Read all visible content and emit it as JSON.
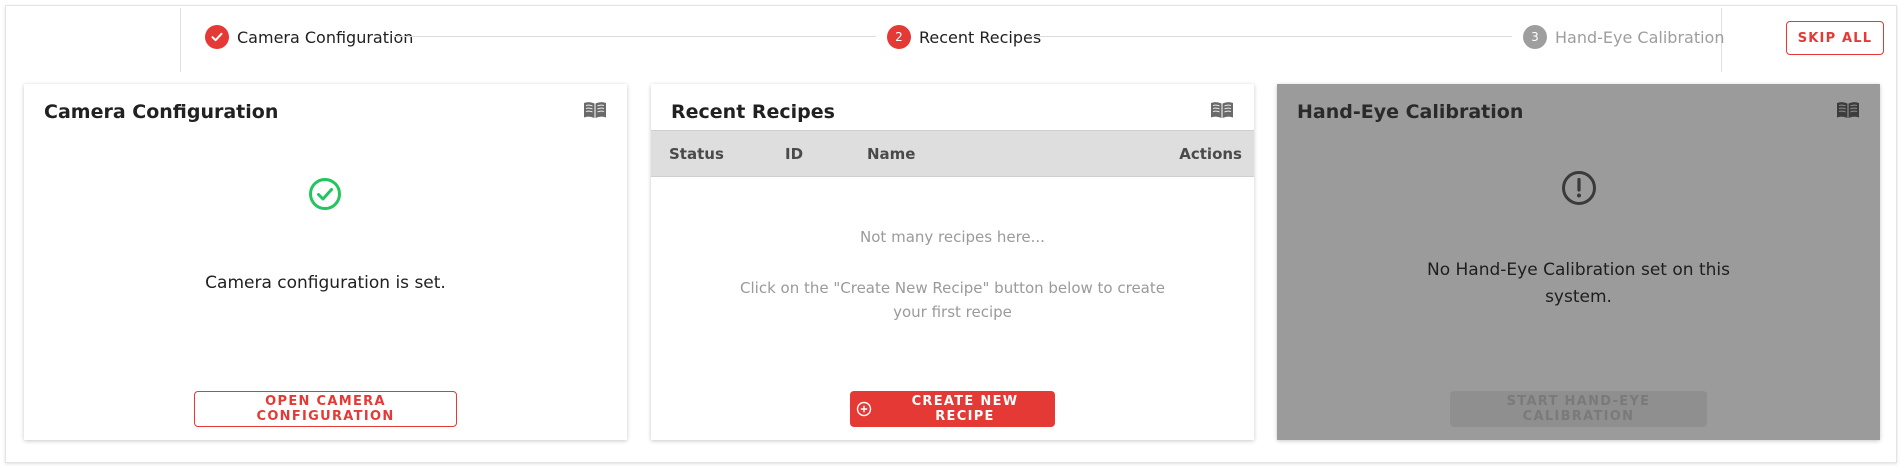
{
  "stepper": {
    "steps": [
      {
        "label": "Camera Configuration",
        "state": "complete"
      },
      {
        "label": "Recent Recipes",
        "number": "2",
        "state": "active"
      },
      {
        "label": "Hand-Eye Calibration",
        "number": "3",
        "state": "pending"
      }
    ],
    "skip_all_label": "SKIP ALL"
  },
  "cards": {
    "camera": {
      "title": "Camera Configuration",
      "status_icon": "check-circle-icon",
      "message": "Camera configuration is set.",
      "button_label": "OPEN CAMERA CONFIGURATION"
    },
    "recipes": {
      "title": "Recent Recipes",
      "columns": [
        "Status",
        "ID",
        "Name",
        "Actions"
      ],
      "empty_title": "Not many recipes here...",
      "empty_hint": "Click on the \"Create New Recipe\" button below to create your first recipe",
      "button_label": "CREATE NEW RECIPE"
    },
    "handeye": {
      "title": "Hand-Eye Calibration",
      "status_icon": "alert-circle-icon",
      "message": "No Hand-Eye Calibration set on this system.",
      "button_label": "START HAND-EYE CALIBRATION"
    }
  },
  "colors": {
    "accent": "#e53935",
    "success": "#22c55e",
    "disabled_panel": "#9b9b9b"
  }
}
